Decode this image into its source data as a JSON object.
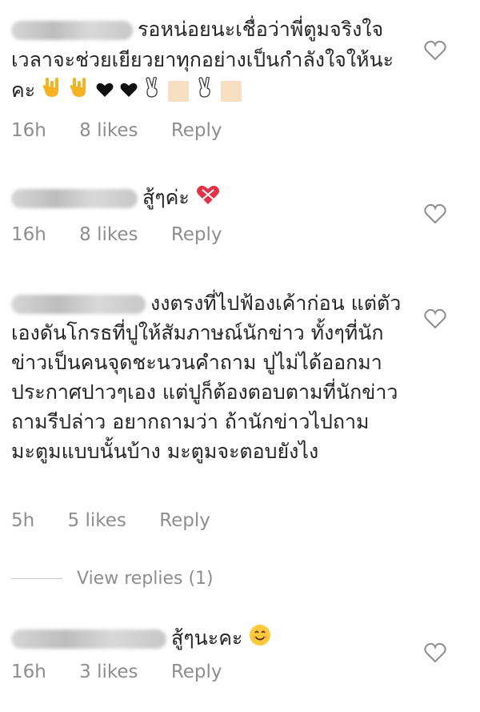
{
  "comments": [
    {
      "text": "รอหน่อยนะเชื่อว่าพี่ตูมจริงใจเวลาจะช่วยเยียวยาทุกอย่างเป็นกำลังใจให้นะคะ",
      "time": "16h",
      "likes": "8 likes",
      "reply": "Reply",
      "icons": [
        "love-you-gesture-icon",
        "love-you-gesture-icon",
        "black-heart-icon",
        "black-heart-icon",
        "victory-hand-icon",
        "skin-tone-square-icon",
        "victory-hand-icon",
        "skin-tone-square-icon"
      ]
    },
    {
      "text": "สู้ๆค่ะ",
      "time": "16h",
      "likes": "8 likes",
      "reply": "Reply",
      "icons": [
        "heart-with-ribbon-icon"
      ]
    },
    {
      "text": "งงตรงที่ไปฟ้องเค้าก่อน แต่ตัวเองดันโกรธที่ปูให้สัมภาษณ์นักข่าว ทั้งๆที่นักข่าวเป็นคนจุดชะนวนคำถาม ปูไม่ได้ออกมาประกาศปาวๆเอง แต่ปูก็ต้องตอบตามที่นักข่าวถามรีปล่าว อยากถามว่า ถ้านักข่าวไปถามมะตูมแบบนั้นบ้าง มะตูมจะตอบยังไง",
      "time": "5h",
      "likes": "5 likes",
      "reply": "Reply"
    },
    {
      "text": "สู้ๆนะคะ",
      "time": "16h",
      "likes": "3 likes",
      "reply": "Reply",
      "icons": [
        "smiling-face-icon"
      ]
    }
  ],
  "view_replies": "View replies (1)",
  "colors": {
    "text": "#262626",
    "meta": "#8e8e8e",
    "heart_outline": "#8e8e8e"
  }
}
